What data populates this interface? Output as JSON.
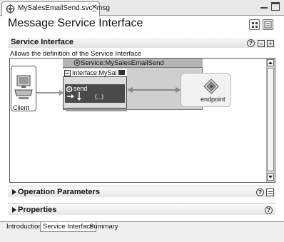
{
  "editor_tab": {
    "title": "MySalesEmailSend.svc_msg",
    "close": "✕"
  },
  "window_controls": {
    "minimize": "minimize-icon",
    "maximize": "maximize-icon"
  },
  "form": {
    "title": "Message Service Interface"
  },
  "service_interface": {
    "title": "Service Interface",
    "description": "Allows the definition of the Service Interface",
    "help": "?",
    "collapse": "–",
    "add": "+",
    "diagram": {
      "client_label": "Client",
      "service_title": "Service:MySalesEmailSend",
      "interface_title": "Interface:MySalesE",
      "operation": "send",
      "operation_params": "(...)",
      "endpoint_label": "endpoint"
    }
  },
  "operation_parameters": {
    "title": "Operation Parameters",
    "help": "?"
  },
  "properties": {
    "title": "Properties",
    "help": "?"
  },
  "page_tabs": [
    {
      "label": "Introduction"
    },
    {
      "label": "Service Interface"
    },
    {
      "label": "Summary"
    }
  ],
  "active_page_tab": "Service Interface"
}
